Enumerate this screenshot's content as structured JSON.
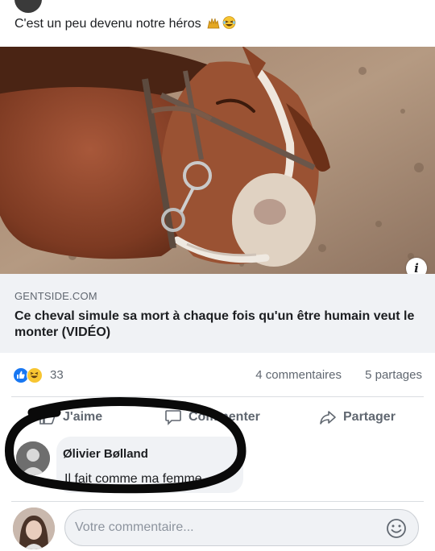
{
  "post": {
    "caption": "C'est un peu devenu notre héros",
    "caption_emojis": [
      "raising-hands-emoji",
      "laughing-emoji"
    ]
  },
  "link_preview": {
    "domain": "GENTSIDE.COM",
    "title": "Ce cheval simule sa mort à chaque fois qu'un être humain veut le monter (VIDÉO)",
    "image": "horse-lying-on-ground-photo"
  },
  "stats": {
    "reaction_icons": [
      "like-icon",
      "haha-icon"
    ],
    "reaction_count": "33",
    "comments": "4 commentaires",
    "shares": "5 partages"
  },
  "actions": {
    "like_label": "J'aime",
    "comment_label": "Commenter",
    "share_label": "Partager"
  },
  "comment": {
    "author": "Ølivier Bølland",
    "text": "Il fait comme ma femme"
  },
  "composer": {
    "placeholder": "Votre commentaire...",
    "emoji_icon": "smiley-icon"
  },
  "colors": {
    "link_bg": "#f0f2f5",
    "secondary_text": "#606770",
    "like_blue": "#1877f2",
    "haha_yellow": "#f7c531"
  }
}
